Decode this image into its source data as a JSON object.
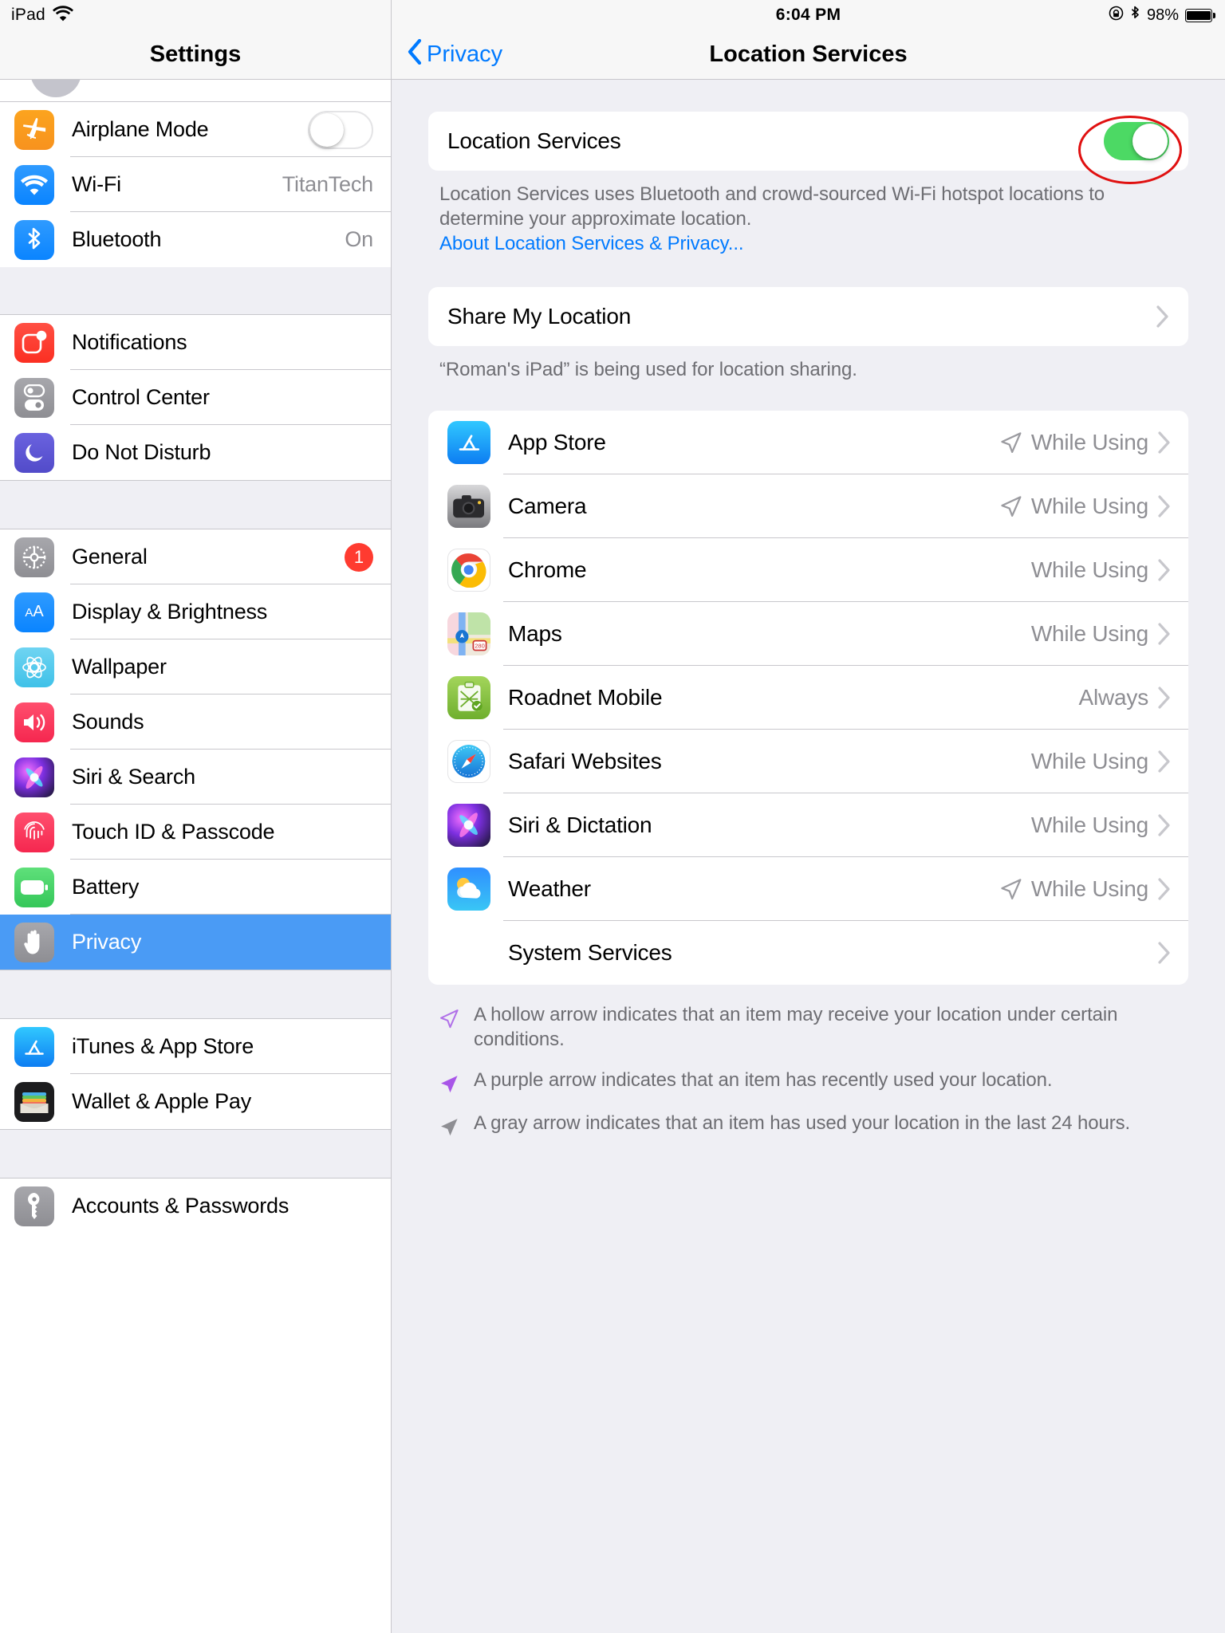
{
  "left": {
    "statusbar": {
      "device": "iPad",
      "wifi_icon": "wifi-icon"
    },
    "title": "Settings",
    "groups": [
      {
        "items": [
          {
            "label": "Airplane Mode",
            "icon": "airplane-icon",
            "control": "toggle-off",
            "value": ""
          },
          {
            "label": "Wi-Fi",
            "icon": "wifi-settings-icon",
            "control": "value",
            "value": "TitanTech"
          },
          {
            "label": "Bluetooth",
            "icon": "bluetooth-icon",
            "control": "value",
            "value": "On"
          }
        ]
      },
      {
        "items": [
          {
            "label": "Notifications",
            "icon": "notifications-icon",
            "control": "none",
            "value": ""
          },
          {
            "label": "Control Center",
            "icon": "control-center-icon",
            "control": "none",
            "value": ""
          },
          {
            "label": "Do Not Disturb",
            "icon": "do-not-disturb-icon",
            "control": "none",
            "value": ""
          }
        ]
      },
      {
        "items": [
          {
            "label": "General",
            "icon": "gear-icon",
            "control": "badge",
            "value": "1"
          },
          {
            "label": "Display & Brightness",
            "icon": "display-brightness-icon",
            "control": "none",
            "value": ""
          },
          {
            "label": "Wallpaper",
            "icon": "wallpaper-icon",
            "control": "none",
            "value": ""
          },
          {
            "label": "Sounds",
            "icon": "sounds-icon",
            "control": "none",
            "value": ""
          },
          {
            "label": "Siri & Search",
            "icon": "siri-icon",
            "control": "none",
            "value": ""
          },
          {
            "label": "Touch ID & Passcode",
            "icon": "touch-id-icon",
            "control": "none",
            "value": ""
          },
          {
            "label": "Battery",
            "icon": "battery-icon",
            "control": "none",
            "value": ""
          },
          {
            "label": "Privacy",
            "icon": "privacy-hand-icon",
            "control": "none",
            "value": "",
            "selected": true
          }
        ]
      },
      {
        "items": [
          {
            "label": "iTunes & App Store",
            "icon": "app-store-icon",
            "control": "none",
            "value": ""
          },
          {
            "label": "Wallet & Apple Pay",
            "icon": "wallet-icon",
            "control": "none",
            "value": ""
          }
        ]
      },
      {
        "items": [
          {
            "label": "Accounts & Passwords",
            "icon": "key-icon",
            "control": "none",
            "value": ""
          }
        ]
      }
    ]
  },
  "right": {
    "statusbar": {
      "time": "6:04 PM",
      "battery_percent": "98%",
      "lock_rotation_icon": "rotation-lock-icon",
      "bluetooth_icon": "bluetooth-icon",
      "battery_icon": "battery-icon"
    },
    "navbar": {
      "back_label": "Privacy",
      "back_icon": "chevron-left-icon",
      "title": "Location Services"
    },
    "master_switch": {
      "label": "Location Services",
      "state": "on",
      "accent_color": "#4CD964",
      "annotation_color": "#E01010"
    },
    "master_footnote": {
      "text": "Location Services uses Bluetooth and crowd-sourced Wi-Fi hotspot locations to determine your approximate location.",
      "link": "About Location Services & Privacy..."
    },
    "share": {
      "label": "Share My Location",
      "chevron_icon": "chevron-right-icon",
      "footnote": "“Roman's iPad” is being used for location sharing."
    },
    "apps": [
      {
        "name": "App Store",
        "value": "While Using",
        "arrow": "hollow-gray",
        "icon": "app-store-icon"
      },
      {
        "name": "Camera",
        "value": "While Using",
        "arrow": "hollow-gray",
        "icon": "camera-icon"
      },
      {
        "name": "Chrome",
        "value": "While Using",
        "arrow": "none",
        "icon": "chrome-icon"
      },
      {
        "name": "Maps",
        "value": "While Using",
        "arrow": "none",
        "icon": "maps-icon"
      },
      {
        "name": "Roadnet Mobile",
        "value": "Always",
        "arrow": "none",
        "icon": "roadnet-icon"
      },
      {
        "name": "Safari Websites",
        "value": "While Using",
        "arrow": "none",
        "icon": "safari-icon"
      },
      {
        "name": "Siri & Dictation",
        "value": "While Using",
        "arrow": "none",
        "icon": "siri-icon"
      },
      {
        "name": "Weather",
        "value": "While Using",
        "arrow": "hollow-gray",
        "icon": "weather-icon"
      },
      {
        "name": "System Services",
        "value": "",
        "arrow": "none",
        "icon": "none"
      }
    ],
    "legend": [
      {
        "arrow": "hollow-purple",
        "text": "A hollow arrow indicates that an item may receive your location under certain conditions."
      },
      {
        "arrow": "solid-purple",
        "text": "A purple arrow indicates that an item has recently used your location."
      },
      {
        "arrow": "solid-gray",
        "text": "A gray arrow indicates that an item has used your location in the last 24 hours."
      }
    ]
  }
}
